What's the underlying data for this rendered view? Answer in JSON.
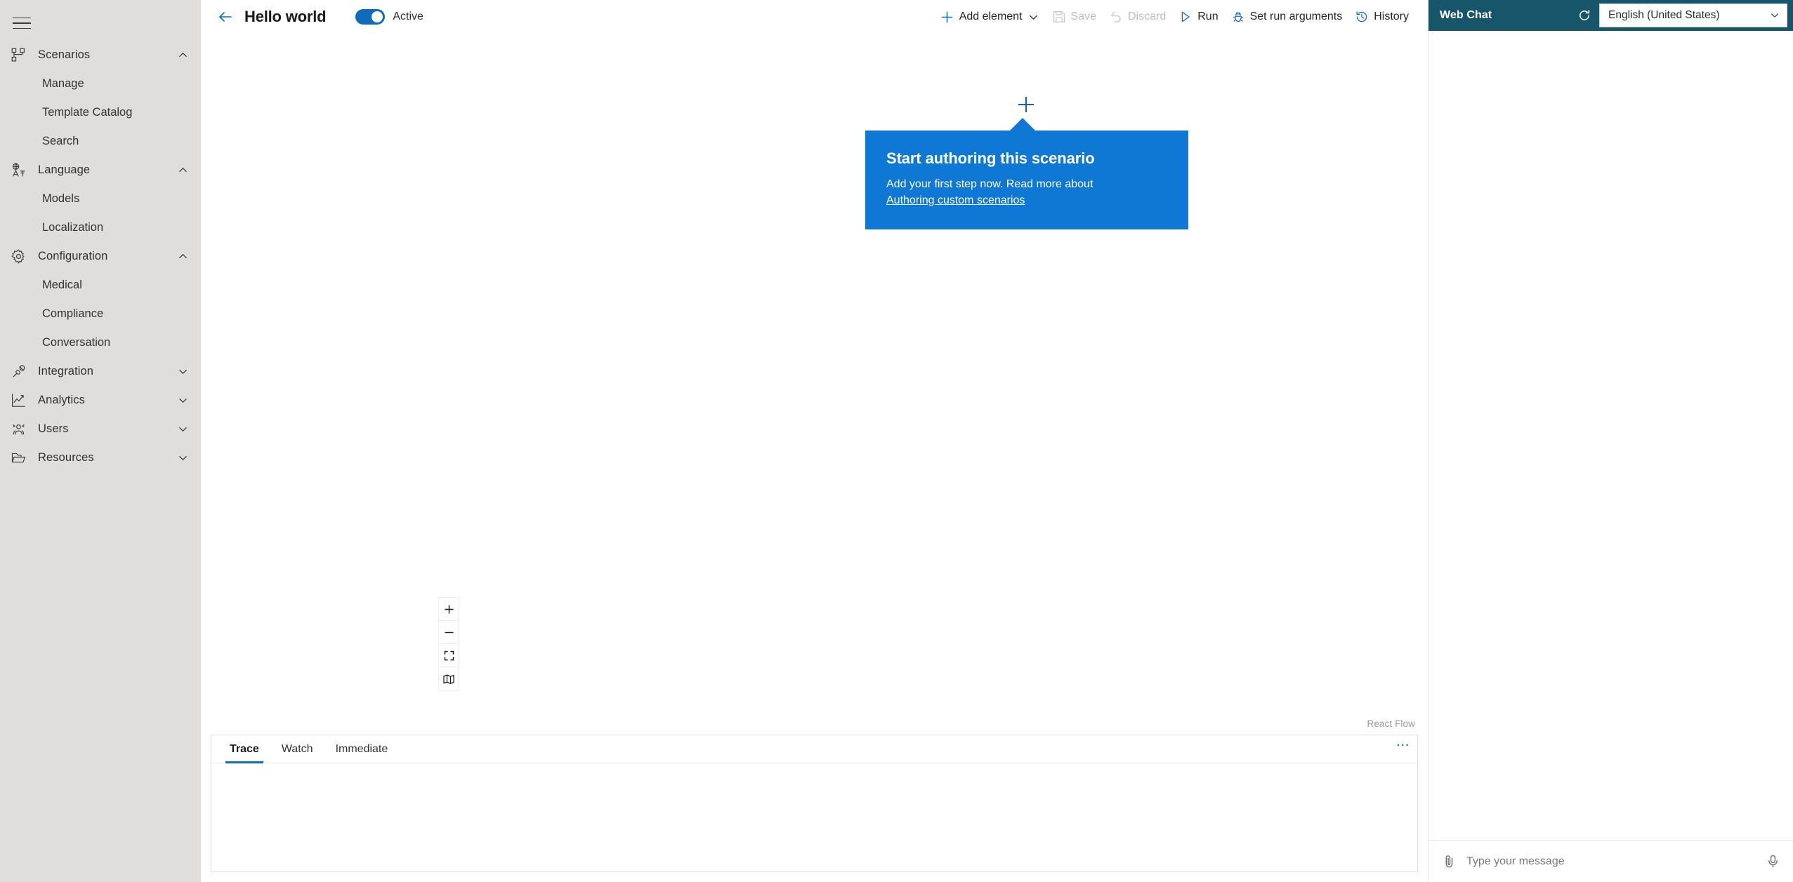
{
  "sidebar": {
    "menu_icon": "hamburger-menu-icon",
    "groups": [
      {
        "label": "Scenarios",
        "icon": "flowchart-icon",
        "expanded": true,
        "chevron": "chevron-up-icon",
        "items": [
          {
            "label": "Manage"
          },
          {
            "label": "Template Catalog"
          },
          {
            "label": "Search"
          }
        ]
      },
      {
        "label": "Language",
        "icon": "translate-icon",
        "expanded": true,
        "chevron": "chevron-up-icon",
        "items": [
          {
            "label": "Models"
          },
          {
            "label": "Localization"
          }
        ]
      },
      {
        "label": "Configuration",
        "icon": "gear-icon",
        "expanded": true,
        "chevron": "chevron-up-icon",
        "items": [
          {
            "label": "Medical"
          },
          {
            "label": "Compliance"
          },
          {
            "label": "Conversation"
          }
        ]
      },
      {
        "label": "Integration",
        "icon": "plug-connected-icon",
        "expanded": false,
        "chevron": "chevron-down-icon",
        "items": []
      },
      {
        "label": "Analytics",
        "icon": "line-chart-icon",
        "expanded": false,
        "chevron": "chevron-down-icon",
        "items": []
      },
      {
        "label": "Users",
        "icon": "people-icon",
        "expanded": false,
        "chevron": "chevron-down-icon",
        "items": []
      },
      {
        "label": "Resources",
        "icon": "folder-icon",
        "expanded": false,
        "chevron": "chevron-down-icon",
        "items": []
      }
    ]
  },
  "commandbar": {
    "back_icon": "back-arrow-icon",
    "title": "Hello world",
    "toggle": {
      "label": "Active",
      "on": true
    },
    "actions": [
      {
        "label": "Add element",
        "icon": "plus-icon",
        "disabled": false,
        "has_dropdown": true
      },
      {
        "label": "Save",
        "icon": "save-disk-icon",
        "disabled": true,
        "has_dropdown": false
      },
      {
        "label": "Discard",
        "icon": "undo-arrow-icon",
        "disabled": true,
        "has_dropdown": false
      },
      {
        "label": "Run",
        "icon": "play-triangle-icon",
        "disabled": false,
        "has_dropdown": false
      },
      {
        "label": "Set run arguments",
        "icon": "bug-icon",
        "disabled": false,
        "has_dropdown": false
      },
      {
        "label": "History",
        "icon": "history-clock-icon",
        "disabled": false,
        "has_dropdown": false
      }
    ]
  },
  "canvas": {
    "add_node_icon": "plus-icon",
    "callout": {
      "title": "Start authoring this scenario",
      "body": "Add your first step now. Read more about",
      "link": "Authoring custom scenarios",
      "background": "#0f78d4"
    },
    "zoom_controls": [
      {
        "icon": "zoom-in-icon",
        "name": "zoom-in-button"
      },
      {
        "icon": "zoom-out-icon",
        "name": "zoom-out-button"
      },
      {
        "icon": "fit-view-icon",
        "name": "fit-view-button"
      },
      {
        "icon": "minimap-icon",
        "name": "toggle-minimap-button"
      }
    ],
    "attribution": "React Flow"
  },
  "bottom_panel": {
    "tabs": [
      {
        "label": "Trace",
        "active": true
      },
      {
        "label": "Watch",
        "active": false
      },
      {
        "label": "Immediate",
        "active": false
      }
    ],
    "more_label": "⋯",
    "content": ""
  },
  "chat": {
    "title": "Web Chat",
    "header_color": "#17566a",
    "refresh_icon": "refresh-icon",
    "language": {
      "selected": "English (United States)",
      "chevron": "chevron-down-icon"
    },
    "attach_icon": "paperclip-icon",
    "mic_icon": "microphone-icon",
    "input_placeholder": "Type your message",
    "input_value": "",
    "messages": []
  },
  "colors": {
    "accent": "#0f6cbd",
    "callout": "#0f78d4",
    "chat_header": "#17566a",
    "sidebar_bg": "#dfdedc"
  }
}
